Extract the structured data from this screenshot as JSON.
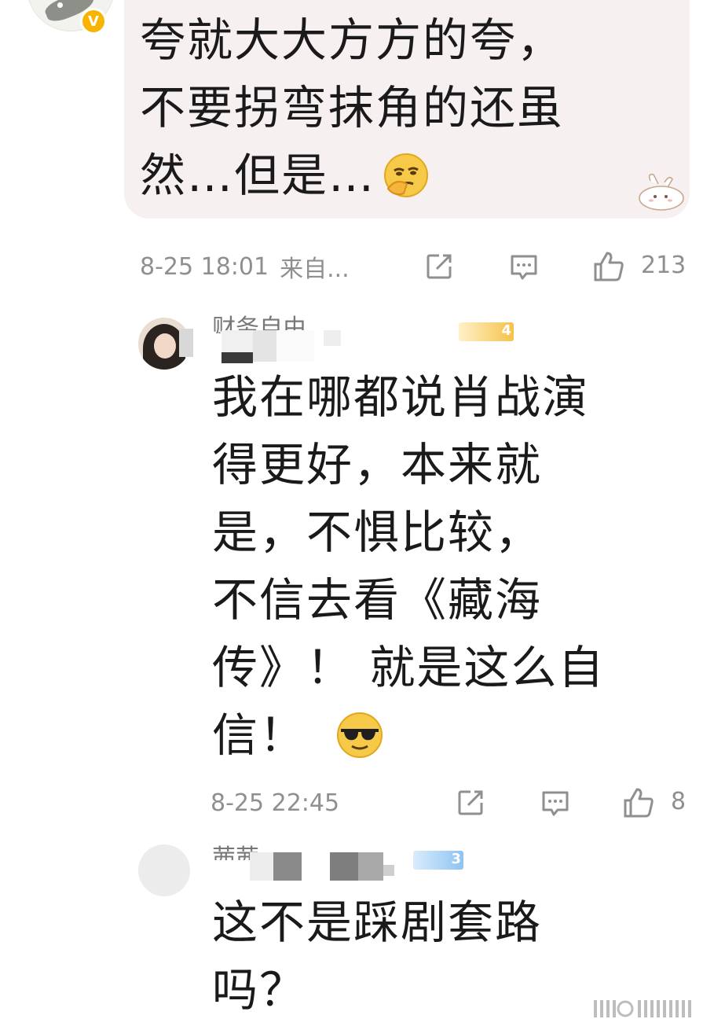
{
  "comment1": {
    "text_line1": "夸就大大方方的夸，",
    "text_line2": "不要拐弯抹角的还虽",
    "text_line3": "然…但是…",
    "emoji": "thinking-face",
    "badge_label": "V",
    "timestamp": "8-25 18:01",
    "source": "来自...",
    "like_count": "213"
  },
  "comment2": {
    "username": "财务自由",
    "level_badge": "4",
    "text_lines": [
      "我在哪都说肖战演",
      "得更好，本来就",
      "是，不惧比较，",
      "不信去看《藏海",
      "传》！ 就是这么自",
      "信！"
    ],
    "emoji": "sunglasses-face",
    "timestamp": "8-25 22:45",
    "like_count": "8"
  },
  "comment3": {
    "username": "茜茜",
    "level_badge": "3",
    "text_lines": [
      "这不是踩剧套路",
      "吗？"
    ]
  },
  "icons": [
    "repost-icon",
    "comment-icon",
    "like-icon"
  ],
  "colors": {
    "bubble_bg": "#f6f0f1",
    "meta_text": "#8f8f8f",
    "vip_badge": "#f7b500",
    "level_badge_orange": "#f5c24b",
    "level_badge_blue": "#8ec3f2"
  }
}
